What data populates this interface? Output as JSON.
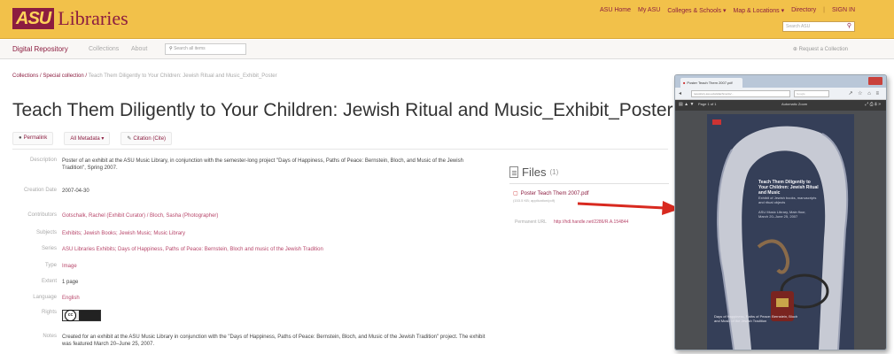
{
  "header": {
    "logo_badge": "ASU",
    "logo_text": "Libraries",
    "links": [
      "ASU Home",
      "My ASU",
      "Colleges & Schools ▾",
      "Map & Locations ▾",
      "Directory",
      "SIGN IN"
    ],
    "search_placeholder": "Search ASU"
  },
  "nav": {
    "brand": "Digital Repository",
    "items": [
      "Collections",
      "About"
    ],
    "search_placeholder": "Search all items",
    "request": "Request a Collection"
  },
  "breadcrumb": {
    "items": [
      "Collections",
      "Special collection"
    ],
    "current": "Teach Them Diligently to Your Children: Jewish Ritual and Music_Exhibit_Poster"
  },
  "title": "Teach Them Diligently to Your Children: Jewish Ritual and Music_Exhibit_Poster",
  "actions": {
    "permalink": "Permalink",
    "metadata": "All Metadata ▾",
    "citation": "Citation (Cite)"
  },
  "metadata": [
    {
      "label": "Description",
      "value": "Poster of an exhibit at the ASU Music Library, in conjunction with the semester-long project \"Days of Happiness, Paths of Peace: Bernstein, Bloch, and Music of the Jewish Tradition\", Spring 2007.",
      "type": "plain"
    },
    {
      "label": "Creation Date",
      "value": "2007-04-30",
      "type": "plain"
    },
    {
      "label": "Contributors",
      "value": "Gotschalk, Rachel (Exhibit Curator) / Bloch, Sasha (Photographer)",
      "type": "link"
    },
    {
      "label": "Subjects",
      "value": "Exhibits; Jewish Books; Jewish Music; Music Library",
      "type": "link"
    },
    {
      "label": "Series",
      "value": "ASU Libraries Exhibits; Days of Happiness, Paths of Peace: Bernstein, Bloch and music of the Jewish Tradition",
      "type": "link"
    },
    {
      "label": "Type",
      "value": "Image",
      "type": "link"
    },
    {
      "label": "Extent",
      "value": "1 page",
      "type": "plain"
    },
    {
      "label": "Language",
      "value": "English",
      "type": "link"
    },
    {
      "label": "Rights",
      "value": "",
      "type": "cc"
    },
    {
      "label": "Notes",
      "value": "Created for an exhibit at the ASU Music Library in conjunction with the \"Days of Happiness, Paths of Peace: Bernstein, Bloch, and Music of the Jewish Tradition\" project. The exhibit was featured March 20–June 25, 2007.",
      "type": "plain"
    }
  ],
  "files": {
    "title": "Files",
    "count": "(1)",
    "file_name": "Poster Teach Them 2007.pdf",
    "file_size": "(153.5 KB; application/pdf)",
    "permalink_label": "Permanent URL",
    "permalink_value": "http://hdl.handle.net/2286/R.A.154844"
  },
  "viewer": {
    "tab_title": "Poster Teach Them 2007.pdf",
    "url": "repository.asu.edu/attachments/...",
    "search": "Google",
    "page_label": "Page 1 of 1",
    "zoom_label": "Automatic Zoom",
    "poster_title": "Teach Them Diligently to Your Children: Jewish Ritual and Music",
    "poster_sub": "Exhibit of Jewish books, manuscripts and ritual objects",
    "poster_dates": "ASU Music Library, Main floor, March 20–June 25, 2007",
    "poster_foot": "Days of Happiness, Paths of Peace: Bernstein, Bloch and Music of the Jewish Tradition"
  }
}
